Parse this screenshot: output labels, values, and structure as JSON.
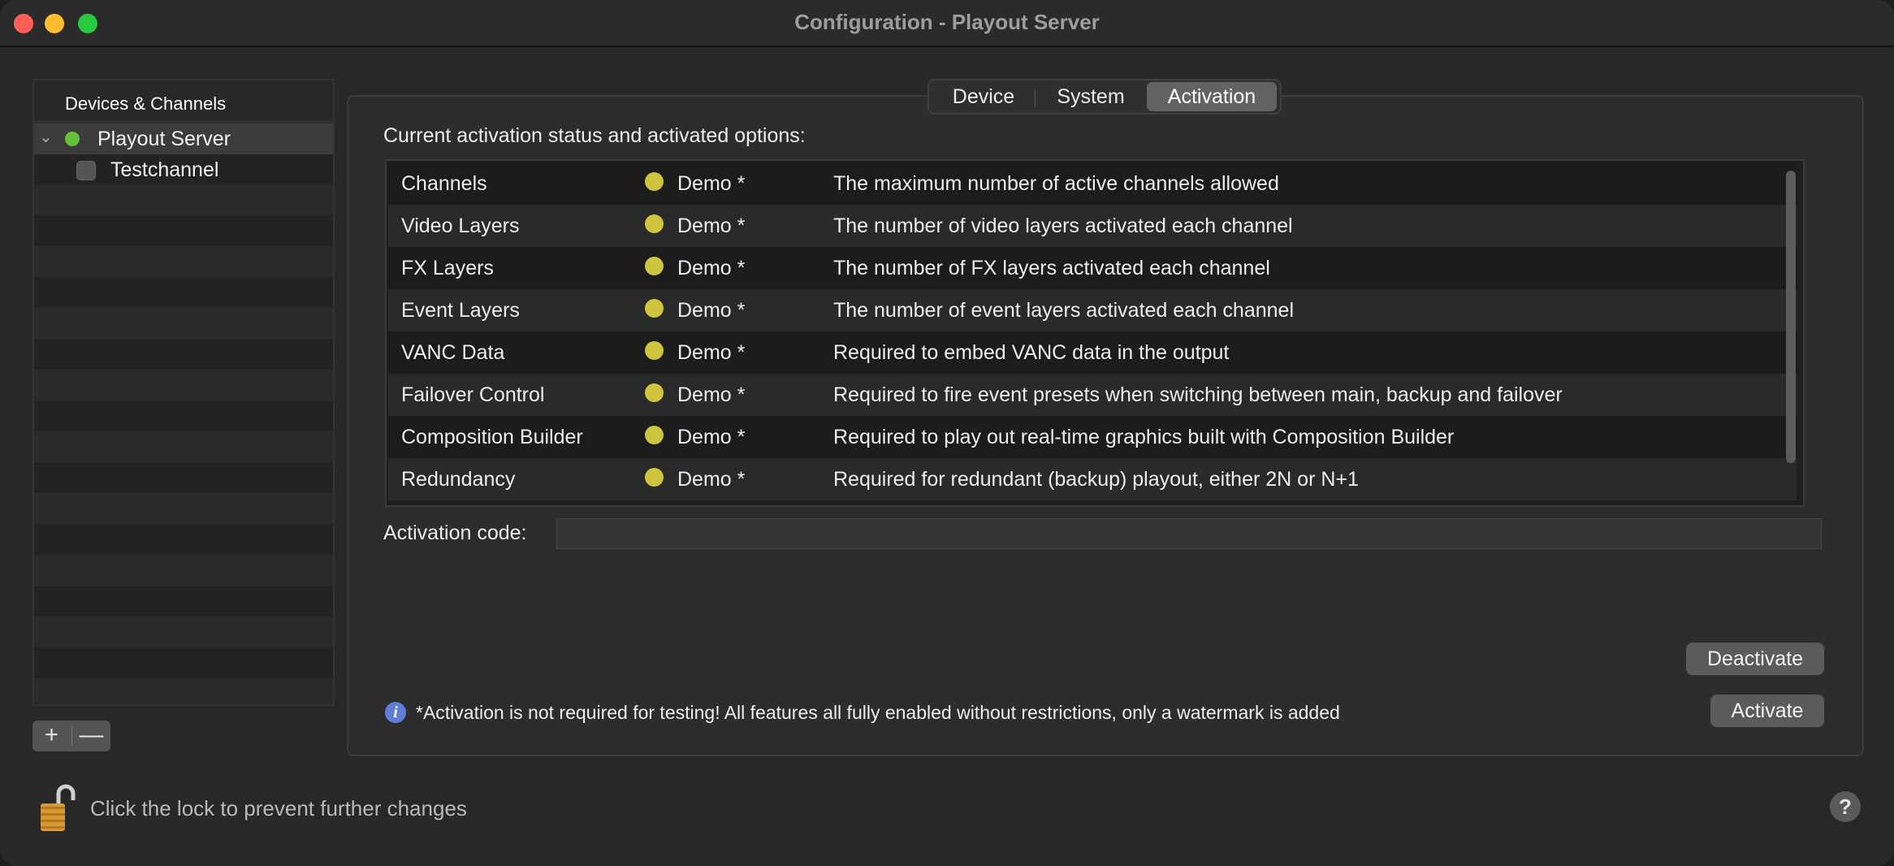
{
  "window": {
    "title": "Configuration - Playout Server"
  },
  "sidebar": {
    "header": "Devices & Channels",
    "items": [
      {
        "label": "Playout Server",
        "status_color": "#64c23a",
        "expanded": true,
        "selected": true
      },
      {
        "label": "Testchannel",
        "checked": false
      }
    ],
    "add_symbol": "+",
    "remove_symbol": "—"
  },
  "tabs": [
    {
      "label": "Device",
      "active": false
    },
    {
      "label": "System",
      "active": false
    },
    {
      "label": "Activation",
      "active": true
    }
  ],
  "activation": {
    "heading": "Current activation status and activated options:",
    "options": [
      {
        "name": "Channels",
        "status": "Demo *",
        "description": "The maximum number of active channels allowed"
      },
      {
        "name": "Video Layers",
        "status": "Demo *",
        "description": "The number of video layers activated each channel"
      },
      {
        "name": "FX Layers",
        "status": "Demo *",
        "description": "The number of FX layers activated each channel"
      },
      {
        "name": "Event Layers",
        "status": "Demo *",
        "description": "The number of event layers activated each channel"
      },
      {
        "name": "VANC Data",
        "status": "Demo *",
        "description": "Required to embed VANC data in the output"
      },
      {
        "name": "Failover Control",
        "status": "Demo *",
        "description": "Required to fire event presets when switching between main, backup and failover"
      },
      {
        "name": "Composition Builder",
        "status": "Demo *",
        "description": "Required to play out real-time graphics built with Composition Builder"
      },
      {
        "name": "Redundancy",
        "status": "Demo *",
        "description": "Required for redundant (backup) playout, either 2N or N+1"
      }
    ],
    "status_color": "#cfc43f",
    "code_label": "Activation code:",
    "code_value": "",
    "deactivate_label": "Deactivate",
    "activate_label": "Activate",
    "info_text": "*Activation is not required for testing! All features all fully enabled without restrictions, only a watermark is added"
  },
  "footer": {
    "lock_text": "Click the lock to prevent further changes",
    "help_label": "?"
  }
}
